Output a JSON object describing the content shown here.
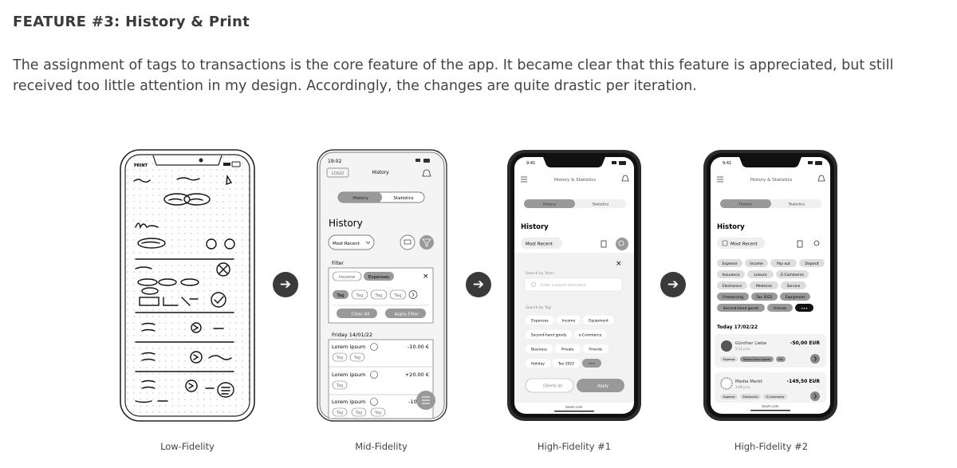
{
  "header": {
    "title": "FEATURE #3: History & Print",
    "description": "The assignment of tags to transactions is the core feature of the app. It became clear that this feature is appreciated, but still received too little attention in my design. Accordingly, the changes are quite drastic per iteration."
  },
  "captions": [
    "Low-Fidelity",
    "Mid-Fidelity",
    "High-Fidelity #1",
    "High-Fidelity #2"
  ],
  "low": {
    "print_label": "PRINT"
  },
  "mid": {
    "time": "19:02",
    "logo": "LOGO",
    "nav_title": "History",
    "tab_history": "History",
    "tab_statistics": "Statistics",
    "page_title": "History",
    "sort_label": "Most Recent",
    "filter_label": "Filter",
    "chip_income": "Income",
    "chip_expenses": "Expenses",
    "tag": "Tag",
    "clear_all": "Clear All",
    "apply_filter": "Apply Filter",
    "date": "Friday 14/01/22",
    "rows": [
      {
        "title": "Lorem ipsum",
        "amount": "-10.00 €"
      },
      {
        "title": "Lorem ipsum",
        "amount": "+20.00 €"
      },
      {
        "title": "Lorem ipsum",
        "amount": "-10"
      }
    ]
  },
  "hf1": {
    "time": "9:41",
    "nav_title": "History & Statistics",
    "tab_history": "History",
    "tab_statistics": "Statistics",
    "page_title": "History",
    "sort_label": "Most Recent",
    "search_by_term": "Search by Term:",
    "search_placeholder": "Enter a search term here",
    "search_by_tag": "Search by Tag:",
    "tags": [
      [
        "Expenses",
        "Income",
        "Equipment"
      ],
      [
        "Second-hand goods",
        "e-Commerce"
      ],
      [
        "Business",
        "Private",
        "Friends"
      ],
      [
        "Holiday",
        "Tax 2022",
        "•••"
      ]
    ],
    "delete_all": "Delete all",
    "apply": "Apply",
    "url": "beam.com"
  },
  "hf2": {
    "time": "9:41",
    "nav_title": "History & Statistics",
    "tab_history": "History",
    "tab_statistics": "Statistics",
    "page_title": "History",
    "sort_label": "Most Recent",
    "tags": [
      [
        "Expense",
        "Income",
        "Pay out",
        "Deposit"
      ],
      [
        "Insurance",
        "Leisure",
        "E-Commerce"
      ],
      [
        "Electronics",
        "Medicine",
        "Service"
      ],
      [
        "Freelancing",
        "Tax 2022",
        "Equipment"
      ],
      [
        "Second-hand goods",
        "Friends",
        "•••"
      ]
    ],
    "date": "Today 17/02/22",
    "tx": [
      {
        "name": "Günther Liebe",
        "time": "5:11 p.m.",
        "amount": "-50,00 EUR",
        "tags": [
          "Expense",
          "Second-hand goods",
          "Fre"
        ]
      },
      {
        "name": "Media Markt",
        "time": "3:46 p.m.",
        "amount": "-149,50 EUR",
        "tags": [
          "Expense",
          "Electronics",
          "E-Commerce"
        ]
      }
    ],
    "url": "beam.com"
  },
  "colors": {
    "dark": "#3a3a3a",
    "arrow": "#3a3a3a",
    "chip_dark": "#8a8a8a",
    "chip_light": "#e4e4e4"
  }
}
